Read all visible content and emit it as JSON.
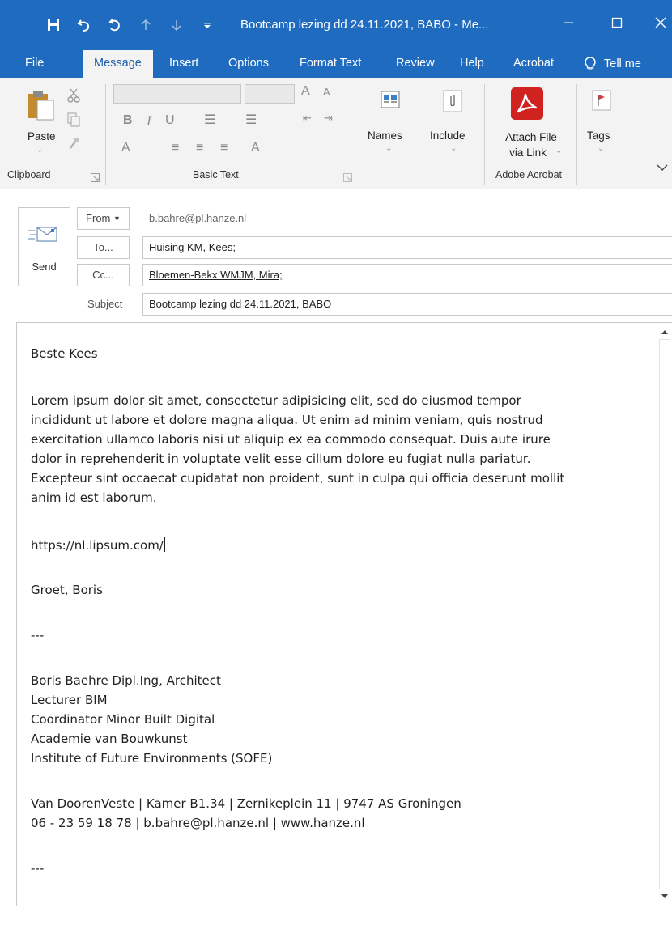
{
  "window": {
    "title": "Bootcamp lezing dd 24.11.2021, BABO  -  Me...",
    "controls": [
      "minimize",
      "maximize",
      "close"
    ]
  },
  "quick_access": [
    {
      "name": "save-icon",
      "label": "Save"
    },
    {
      "name": "undo-icon",
      "label": "Undo"
    },
    {
      "name": "redo-icon",
      "label": "Redo"
    },
    {
      "name": "up-arrow-icon",
      "label": "Previous Item"
    },
    {
      "name": "down-arrow-icon",
      "label": "Next Item"
    },
    {
      "name": "customize-qat-icon",
      "label": "Customize"
    }
  ],
  "tabs": [
    {
      "label": "File"
    },
    {
      "label": "Message",
      "active": true
    },
    {
      "label": "Insert"
    },
    {
      "label": "Options"
    },
    {
      "label": "Format Text"
    },
    {
      "label": "Review"
    },
    {
      "label": "Help"
    },
    {
      "label": "Acrobat"
    },
    {
      "label": "Tell me"
    }
  ],
  "ribbon": {
    "clipboard": {
      "paste": "Paste",
      "group": "Clipboard"
    },
    "basic_text": {
      "group": "Basic Text"
    },
    "names": {
      "label": "Names"
    },
    "include": {
      "label": "Include"
    },
    "acrobat": {
      "attach_line1": "Attach File",
      "attach_line2": "via Link",
      "group": "Adobe Acrobat"
    },
    "tags": {
      "label": "Tags"
    }
  },
  "header": {
    "send": "Send",
    "from_button": "From",
    "from_value": "b.bahre@pl.hanze.nl",
    "to_button": "To...",
    "to_value": "Huising KM, Kees;",
    "cc_button": "Cc...",
    "cc_value": "Bloemen-Bekx WMJM, Mira;",
    "subject_label": "Subject",
    "subject_value": "Bootcamp lezing dd 24.11.2021, BABO"
  },
  "body": {
    "greeting": "Beste Kees",
    "paragraph_lines": [
      "Lorem ipsum dolor sit amet, consectetur adipisicing elit, sed do eiusmod tempor",
      "incididunt ut labore et dolore magna aliqua. Ut enim ad minim veniam, quis nostrud",
      "exercitation ullamco laboris nisi ut aliquip ex ea commodo consequat. Duis aute irure",
      "dolor in reprehenderit in voluptate velit esse cillum dolore eu fugiat nulla pariatur.",
      "Excepteur sint occaecat cupidatat non proident, sunt in culpa qui officia deserunt mollit",
      "anim id est laborum."
    ],
    "link": "https://nl.lipsum.com/",
    "closing": "Groet, Boris",
    "divider_1": "---",
    "signature": [
      "Boris Baehre Dipl.Ing, Architect",
      "Lecturer BIM",
      "Coordinator Minor Built Digital",
      "Academie van Bouwkunst",
      "Institute of Future Environments (SOFE)"
    ],
    "address_line": "Van DoorenVeste | Kamer B1.34 | Zernikeplein 11 |  9747 AS Groningen",
    "contact_line": "06 - 23 59 18 78 | b.bahre@pl.hanze.nl | www.hanze.nl",
    "divider_2": "---"
  },
  "colors": {
    "title_bar": "#1e6bbf",
    "ribbon_bg": "#f3f3f3",
    "spell_underline": "#d83b3b",
    "acrobat_red": "#d0231f"
  }
}
